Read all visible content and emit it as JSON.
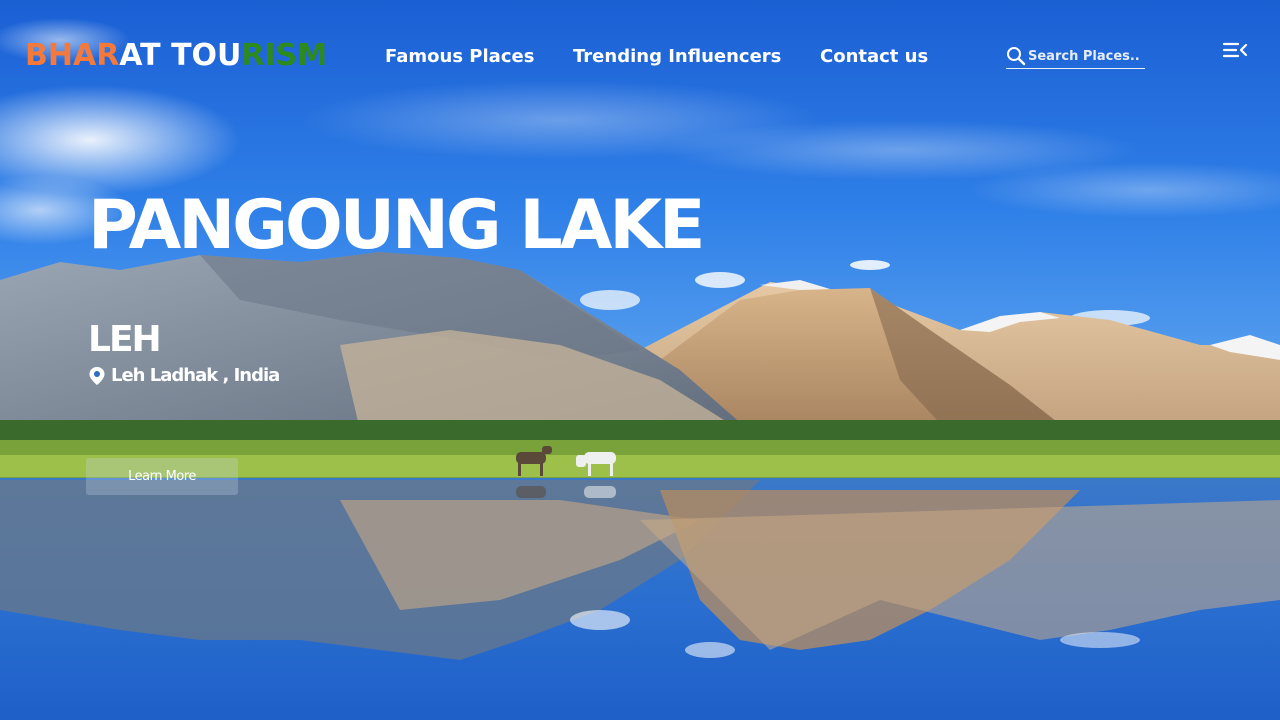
{
  "brand": {
    "part_saffron": "BHAR",
    "part_white": "AT TOU",
    "part_green": "RISM"
  },
  "nav": {
    "items": [
      {
        "label": "Famous Places"
      },
      {
        "label": "Trending Influencers"
      },
      {
        "label": "Contact us"
      }
    ]
  },
  "search": {
    "placeholder": "Search Places.."
  },
  "hero": {
    "title": "PANGOUNG LAKE",
    "subtitle": "LEH",
    "location": "Leh Ladhak , India",
    "cta_label": "Learn More"
  },
  "icons": {
    "search": "search-icon",
    "menu": "menu-collapse-icon",
    "location": "map-pin-icon"
  },
  "colors": {
    "saffron": "#f5793a",
    "green": "#2d8a1f",
    "white": "#ffffff",
    "sky": "#2f7fe6"
  }
}
